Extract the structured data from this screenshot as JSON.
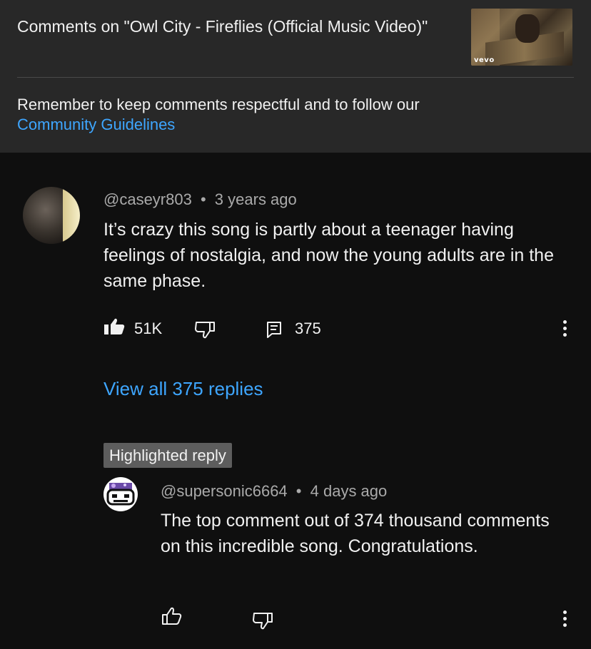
{
  "header": {
    "title": "Comments on \"Owl City - Fireflies (Official Music Video)\"",
    "thumbnail_label": "vevo",
    "notice_text": "Remember to keep comments respectful and to follow our",
    "notice_link": "Community Guidelines"
  },
  "comment": {
    "author": "@caseyr803",
    "separator": "•",
    "time": "3 years ago",
    "text": "It’s crazy this song is partly about a teenager having feelings of nostalgia, and now the young adults are in the same phase.",
    "likes": "51K",
    "replies_count": "375",
    "view_replies": "View all 375 replies",
    "icons": {
      "like": "thumbs-up-filled-icon",
      "dislike": "thumbs-down-icon",
      "reply": "reply-icon",
      "more": "more-vertical-icon"
    }
  },
  "reply": {
    "badge": "Highlighted reply",
    "author": "@supersonic6664",
    "separator": "•",
    "time": "4 days ago",
    "text": "The top comment out of 374 thousand comments on this incredible song. Congratulations."
  },
  "colors": {
    "background": "#0f0f0f",
    "header": "#282828",
    "link": "#3ea6ff",
    "secondary_text": "#aaaaaa"
  }
}
